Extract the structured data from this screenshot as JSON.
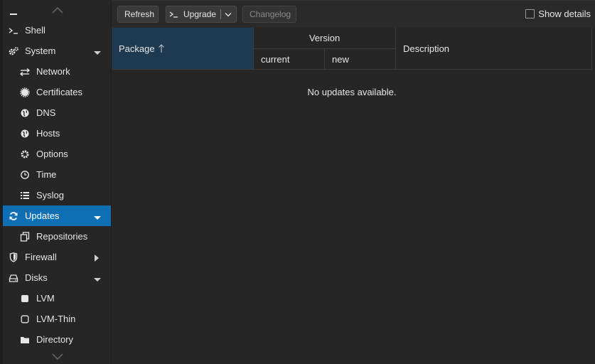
{
  "sidebar": {
    "items": [
      {
        "label": "Shell",
        "icon": "terminal-icon"
      },
      {
        "label": "System",
        "icon": "cogs-icon"
      },
      {
        "label": "Network",
        "icon": "exchange-icon"
      },
      {
        "label": "Certificates",
        "icon": "certificate-icon"
      },
      {
        "label": "DNS",
        "icon": "globe-icon"
      },
      {
        "label": "Hosts",
        "icon": "globe-icon"
      },
      {
        "label": "Options",
        "icon": "gear-icon"
      },
      {
        "label": "Time",
        "icon": "clock-icon"
      },
      {
        "label": "Syslog",
        "icon": "list-icon"
      },
      {
        "label": "Updates",
        "icon": "refresh-icon"
      },
      {
        "label": "Repositories",
        "icon": "files-icon"
      },
      {
        "label": "Firewall",
        "icon": "shield-icon"
      },
      {
        "label": "Disks",
        "icon": "hdd-icon"
      },
      {
        "label": "LVM",
        "icon": "square-icon"
      },
      {
        "label": "LVM-Thin",
        "icon": "square-outline-icon"
      },
      {
        "label": "Directory",
        "icon": "folder-icon"
      }
    ],
    "selected": "Updates"
  },
  "toolbar": {
    "refresh_label": "Refresh",
    "upgrade_label": "Upgrade",
    "changelog_label": "Changelog",
    "show_details_label": "Show details"
  },
  "grid": {
    "columns": {
      "package": "Package",
      "version": "Version",
      "current": "current",
      "new": "new",
      "description": "Description"
    },
    "empty_text": "No updates available."
  },
  "colors": {
    "accent": "#0e6fb4",
    "sorted_header": "#1d3a50",
    "background": "#262626"
  }
}
